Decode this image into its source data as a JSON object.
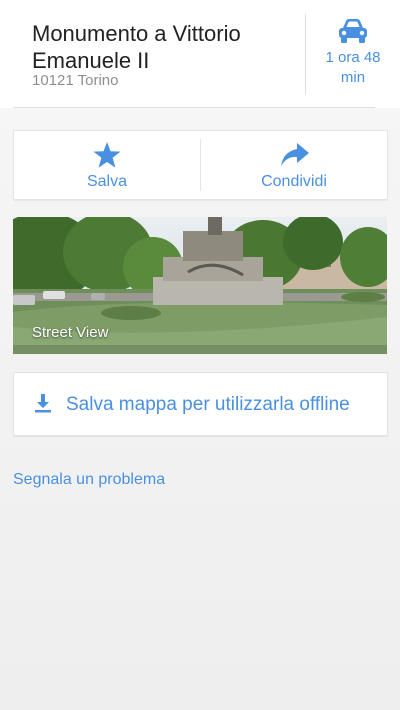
{
  "place": {
    "name": "Monumento a Vittorio Emanuele II",
    "address": "10121 Torino"
  },
  "directions": {
    "icon": "car-icon",
    "eta": "1 ora 48 min"
  },
  "actions": {
    "save_label": "Salva",
    "share_label": "Condividi",
    "save_icon": "star-icon",
    "share_icon": "share-arrow-icon"
  },
  "street_view": {
    "label": "Street View"
  },
  "offline": {
    "label": "Salva mappa per utilizzarla offline",
    "icon": "download-icon"
  },
  "report": {
    "label": "Segnala un problema"
  },
  "colors": {
    "accent": "#4a90e2",
    "title": "#222222",
    "subtitle": "#8e8e8e"
  }
}
